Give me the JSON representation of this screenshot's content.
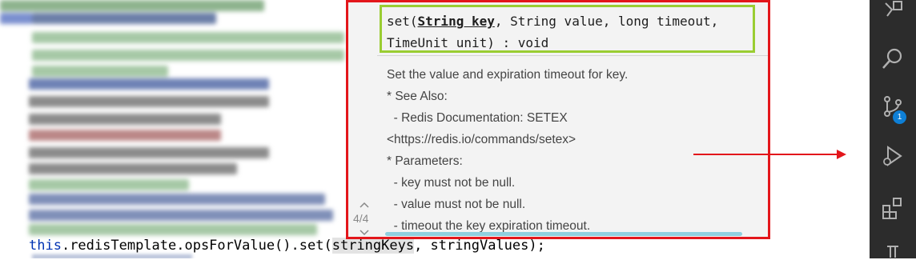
{
  "popup": {
    "signature_prefix": "set(",
    "signature_bold": "String key",
    "signature_rest_line1": ", String value, long timeout,",
    "signature_line2": "TimeUnit unit) : void",
    "doc_lines": [
      "Set the value and expiration timeout for key.",
      "* See Also:",
      "  - Redis Documentation: SETEX",
      "<https://redis.io/commands/setex>",
      "* Parameters:",
      "  - key must not be null.",
      "  - value must not be null.",
      "  - timeout the key expiration timeout."
    ],
    "overload_counter": "4/4",
    "nav_up": "^",
    "nav_down": "v"
  },
  "editor": {
    "code_this": "this",
    "code_mid": ".redisTemplate.opsForValue().set(",
    "code_highlighted": "stringKeys",
    "code_end": ", stringValues);"
  },
  "activity_bar": {
    "icons": [
      "extensions-alt-icon",
      "search-icon",
      "source-control-icon",
      "run-debug-icon",
      "extensions-icon",
      "testing-icon"
    ],
    "source_control_badge": "1"
  },
  "colors": {
    "annotation_red": "#e3161b",
    "annotation_green": "#9acd32",
    "badge_blue": "#0e7fd6",
    "activity_bg": "#2c2c2c"
  }
}
